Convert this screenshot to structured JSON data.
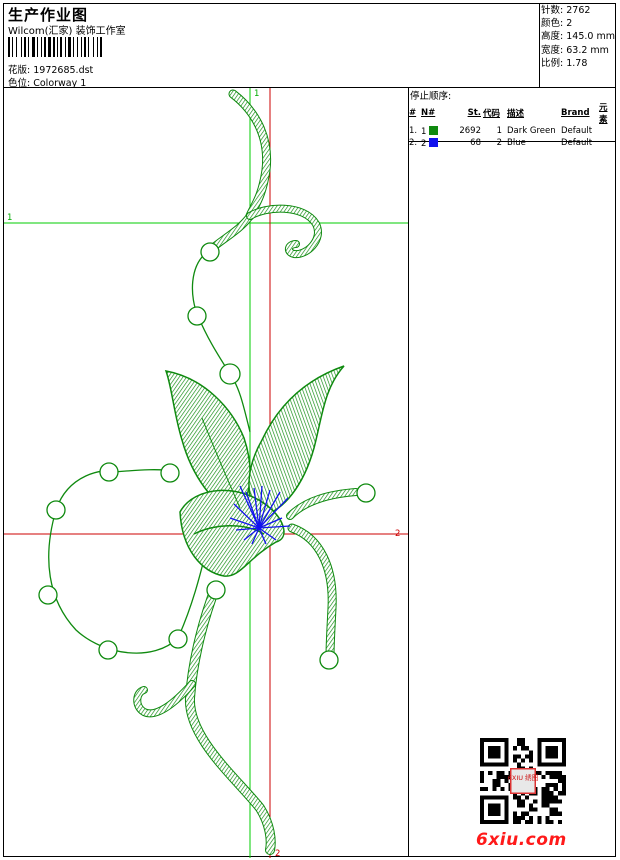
{
  "header": {
    "title": "生产作业图",
    "studio": "Wilcom(汇家) 装饰工作室",
    "design_label": "花版:",
    "design_file": "1972685.dst",
    "colorway_label": "色位:",
    "colorway": "Colorway 1"
  },
  "stats": [
    {
      "label": "针数:",
      "value": "2762"
    },
    {
      "label": "颜色:",
      "value": "2"
    },
    {
      "label": "高度:",
      "value": "145.0 mm"
    },
    {
      "label": "宽度:",
      "value": "63.2 mm"
    },
    {
      "label": "比例:",
      "value": "1.78"
    }
  ],
  "stop_sequence": {
    "title": "停止顺序:",
    "columns": [
      "#",
      "N#",
      "St.",
      "代码",
      "描述",
      "Brand",
      "元素"
    ],
    "rows": [
      {
        "index": "1.",
        "n": "1",
        "color": "#0f8a0f",
        "stitches": "2692",
        "code": "1",
        "desc": "Dark Green",
        "brand": "Default",
        "elements": ""
      },
      {
        "index": "2.",
        "n": "2",
        "color": "#1212ee",
        "stitches": "68",
        "code": "2",
        "desc": "Blue",
        "brand": "Default",
        "elements": ""
      }
    ]
  },
  "guides": {
    "green_v_label": "1",
    "green_h_label": "1",
    "red_h_label": "2",
    "red_v_label": "2"
  },
  "colors": {
    "thread_green": "#0f8a0f",
    "thread_blue": "#1212ee",
    "guide_green": "#00cc00",
    "guide_red": "#cc0000",
    "watermark": "#ff1a1a"
  },
  "watermark": {
    "text": "6xiu.com",
    "seal_text": "6XIU 绣图"
  }
}
